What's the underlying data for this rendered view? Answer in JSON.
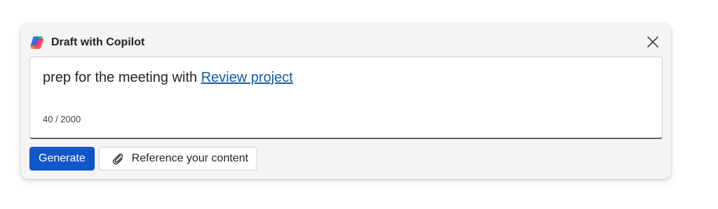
{
  "dialog": {
    "title": "Draft with Copilot",
    "logo_icon": "copilot-logo-icon",
    "close_icon": "close-icon"
  },
  "editor": {
    "prompt_text": "prep for the meeting with ",
    "prompt_link": "Review project",
    "char_count": "40 / 2000"
  },
  "actions": {
    "generate_label": "Generate",
    "reference_label": "Reference your content",
    "reference_icon": "paperclip-icon"
  },
  "colors": {
    "primary": "#1057c8",
    "link": "#115ea3",
    "card_background": "#f5f5f5"
  }
}
